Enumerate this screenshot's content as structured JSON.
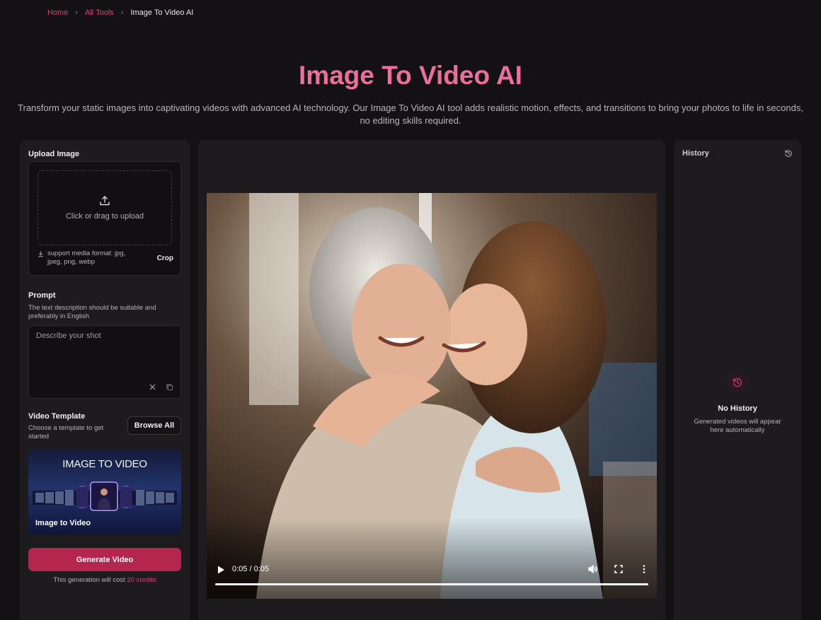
{
  "breadcrumb": {
    "home": "Home",
    "all_tools": "All Tools",
    "current": "Image To Video AI"
  },
  "hero": {
    "title": "Image To Video AI",
    "subtitle": "Transform your static images into captivating videos with advanced AI technology. Our Image To Video AI tool adds realistic motion, effects, and transitions to bring your photos to life in seconds, no editing skills required."
  },
  "upload": {
    "title": "Upload Image",
    "dropzone_label": "Click or drag to upload",
    "format_hint": "support media format: jpg, jpeg, png, webp",
    "crop_label": "Crop",
    "icon": "upload-icon"
  },
  "prompt": {
    "title": "Prompt",
    "hint": "The text description should be suitable and preferably in English",
    "placeholder": "Describe your shot",
    "value": ""
  },
  "template": {
    "title": "Video Template",
    "hint": "Choose a template to get started",
    "browse_label": "Browse All",
    "card_title": "IMAGE TO VIDEO",
    "card_label": "Image to Video"
  },
  "generate": {
    "button_label": "Generate Video",
    "cost_prefix": "This generation will cost",
    "cost_credits": "20 credits"
  },
  "player": {
    "time": "0:05 / 0:05",
    "progress": 1.0,
    "controls": [
      "play-icon",
      "volume-icon",
      "fullscreen-icon",
      "more-vert-icon"
    ]
  },
  "history": {
    "title": "History",
    "empty_title": "No History",
    "empty_hint": "Generated videos will appear here automatically"
  },
  "colors": {
    "accent": "#d6456f",
    "title_pink": "#ec6f9a",
    "button": "#b5264f",
    "background": "#141114",
    "panel": "#1e1b1f"
  }
}
